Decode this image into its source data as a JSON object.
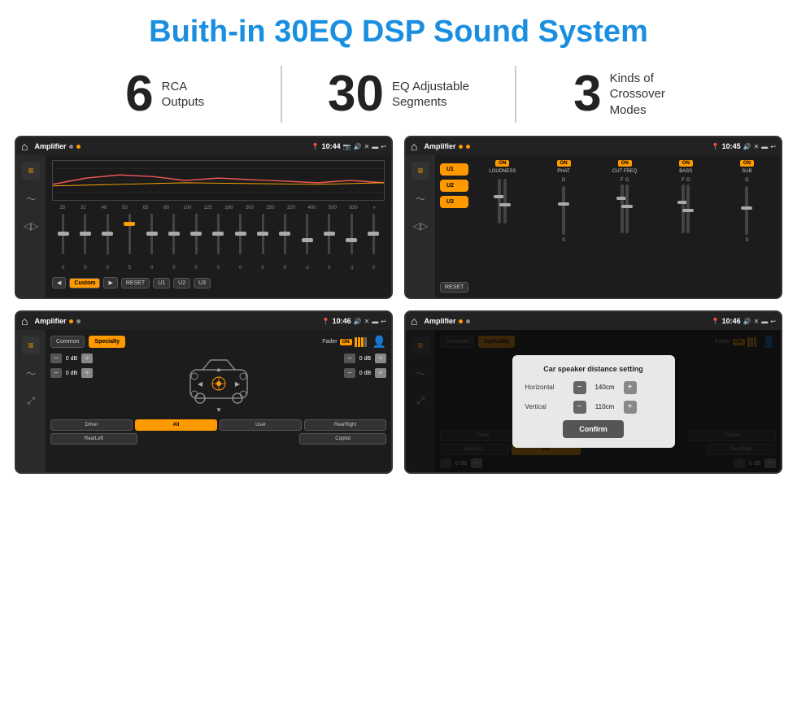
{
  "page": {
    "title": "Buith-in 30EQ DSP Sound System"
  },
  "stats": [
    {
      "number": "6",
      "label": "RCA\nOutputs"
    },
    {
      "number": "30",
      "label": "EQ Adjustable\nSegments"
    },
    {
      "number": "3",
      "label": "Kinds of\nCrossover Modes"
    }
  ],
  "screens": [
    {
      "id": "eq-screen",
      "statusbar": {
        "title": "Amplifier",
        "time": "10:44"
      },
      "type": "eq"
    },
    {
      "id": "effects-screen",
      "statusbar": {
        "title": "Amplifier",
        "time": "10:45"
      },
      "type": "effects"
    },
    {
      "id": "crossover-screen",
      "statusbar": {
        "title": "Amplifier",
        "time": "10:46"
      },
      "type": "crossover"
    },
    {
      "id": "dialog-screen",
      "statusbar": {
        "title": "Amplifier",
        "time": "10:46"
      },
      "type": "dialog"
    }
  ],
  "eq": {
    "frequencies": [
      "25",
      "32",
      "40",
      "50",
      "63",
      "80",
      "100",
      "125",
      "160",
      "200",
      "250",
      "320",
      "400",
      "500",
      "630"
    ],
    "values": [
      "0",
      "0",
      "0",
      "5",
      "0",
      "0",
      "0",
      "0",
      "0",
      "0",
      "0",
      "-1",
      "0",
      "-1"
    ],
    "presets": [
      "Custom",
      "RESET",
      "U1",
      "U2",
      "U3"
    ]
  },
  "effects": {
    "presets": [
      "U1",
      "U2",
      "U3"
    ],
    "controls": [
      {
        "name": "LOUDNESS",
        "on": true
      },
      {
        "name": "PHAT",
        "on": true
      },
      {
        "name": "CUT FREQ",
        "on": true
      },
      {
        "name": "BASS",
        "on": true
      },
      {
        "name": "SUB",
        "on": true
      }
    ],
    "reset": "RESET"
  },
  "crossover": {
    "tabs": [
      "Common",
      "Specialty"
    ],
    "fader_label": "Fader",
    "db_rows": [
      {
        "value": "0 dB"
      },
      {
        "value": "0 dB"
      },
      {
        "value": "0 dB"
      },
      {
        "value": "0 dB"
      }
    ],
    "bottom_btns": [
      "Driver",
      "All",
      "User",
      "RearRight",
      "RearLeft",
      "Copilot"
    ]
  },
  "dialog": {
    "title": "Car speaker distance setting",
    "fields": [
      {
        "label": "Horizontal",
        "value": "140cm"
      },
      {
        "label": "Vertical",
        "value": "110cm"
      }
    ],
    "confirm": "Confirm",
    "db_rows": [
      {
        "value": "0 dB"
      },
      {
        "value": "0 dB"
      }
    ]
  }
}
